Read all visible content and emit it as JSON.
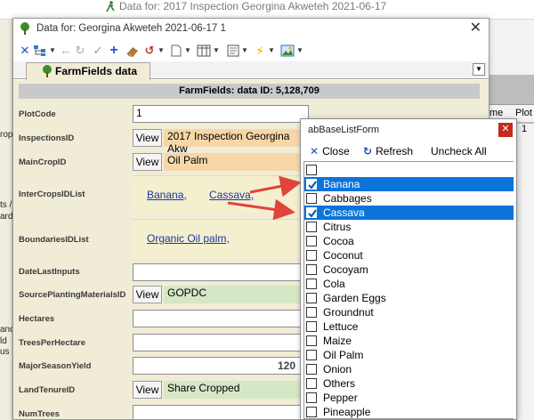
{
  "background_window": {
    "title": "Data for: 2017 Inspection Georgina Akweteh 2021-06-17",
    "left_fragments": [
      "rop",
      "ts /",
      "ard",
      "and",
      "ld",
      "us"
    ],
    "right_headers": [
      "me",
      "Plot"
    ],
    "right_values": [
      "1"
    ]
  },
  "window": {
    "title": "Data for:  Georgina Akweteh 2021-06-17 1",
    "tab_label": "FarmFields data",
    "header": "FarmFields: data ID: 5,128,709"
  },
  "fields": {
    "plotcode": {
      "label": "PlotCode",
      "value": "1"
    },
    "inspectionsid": {
      "label": "InspectionsID",
      "button": "View",
      "value": "2017 Inspection Georgina Akw"
    },
    "maincropid": {
      "label": "MainCropID",
      "button": "View",
      "value": "Oil Palm"
    },
    "intercrops": {
      "label": "InterCropsIDList",
      "items": [
        "Banana,",
        "Cassava,"
      ]
    },
    "boundaries": {
      "label": "BoundariesIDList",
      "items": [
        "Organic Oil palm,"
      ]
    },
    "datelastinputs": {
      "label": "DateLastInputs",
      "value": ""
    },
    "sourceplanting": {
      "label": "SourcePlantingMaterialsID",
      "button": "View",
      "value": "GOPDC"
    },
    "hectares": {
      "label": "Hectares",
      "value": ""
    },
    "treesperhectare": {
      "label": "TreesPerHectare",
      "value": ""
    },
    "majorseasonyield": {
      "label": "MajorSeasonYield",
      "value": "120"
    },
    "landtenure": {
      "label": "LandTenureID",
      "button": "View",
      "value": "Share Cropped"
    },
    "numtrees": {
      "label": "NumTrees",
      "value": ""
    }
  },
  "popup": {
    "title": "abBaseListForm",
    "close_label": "Close",
    "refresh_label": "Refresh",
    "uncheck_label": "Uncheck All",
    "items": [
      {
        "label": "",
        "checked": false,
        "selected": false
      },
      {
        "label": "Banana",
        "checked": true,
        "selected": true
      },
      {
        "label": "Cabbages",
        "checked": false,
        "selected": false
      },
      {
        "label": "Cassava",
        "checked": true,
        "selected": true
      },
      {
        "label": "Citrus",
        "checked": false,
        "selected": false
      },
      {
        "label": "Cocoa",
        "checked": false,
        "selected": false
      },
      {
        "label": "Coconut",
        "checked": false,
        "selected": false
      },
      {
        "label": "Cocoyam",
        "checked": false,
        "selected": false
      },
      {
        "label": "Cola",
        "checked": false,
        "selected": false
      },
      {
        "label": "Garden Eggs",
        "checked": false,
        "selected": false
      },
      {
        "label": "Groundnut",
        "checked": false,
        "selected": false
      },
      {
        "label": "Lettuce",
        "checked": false,
        "selected": false
      },
      {
        "label": "Maize",
        "checked": false,
        "selected": false
      },
      {
        "label": "Oil Palm",
        "checked": false,
        "selected": false
      },
      {
        "label": "Onion",
        "checked": false,
        "selected": false
      },
      {
        "label": "Others",
        "checked": false,
        "selected": false
      },
      {
        "label": "Pepper",
        "checked": false,
        "selected": false
      },
      {
        "label": "Pineapple",
        "checked": false,
        "selected": false
      }
    ]
  },
  "colors": {
    "form_bg": "#f1ecd6",
    "fk_orange": "#f7d7a8",
    "fk_green": "#d6e7c6",
    "selection": "#0b74d8",
    "annotation_arrow": "#e0443a"
  }
}
